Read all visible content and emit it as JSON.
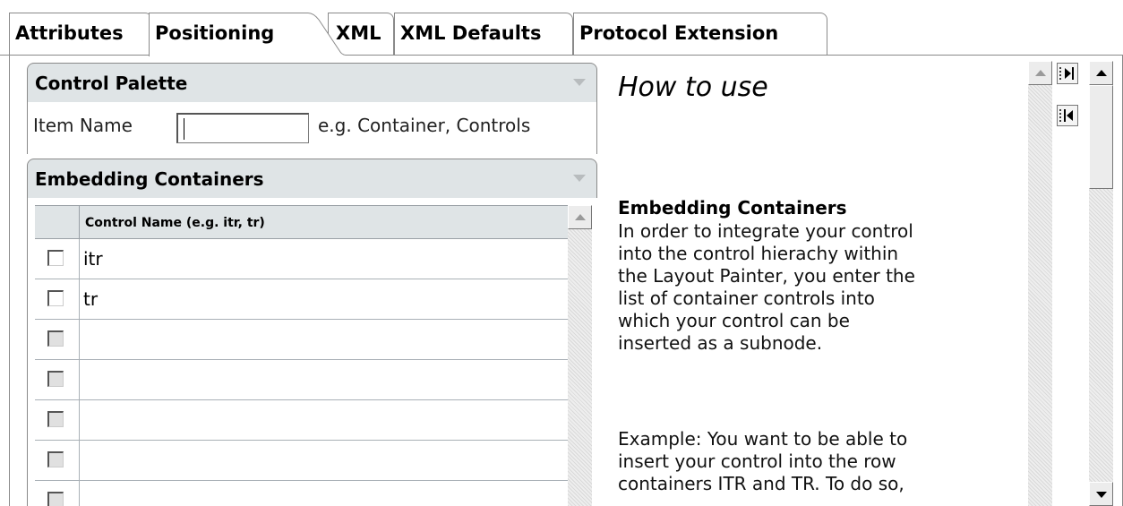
{
  "tabs": [
    {
      "label": "Attributes",
      "active": false
    },
    {
      "label": "Positioning",
      "active": true
    },
    {
      "label": "XML",
      "active": false
    },
    {
      "label": "XML Defaults",
      "active": false
    },
    {
      "label": "Protocol Extension",
      "active": false
    }
  ],
  "control_palette": {
    "title": "Control Palette",
    "item_name_label": "Item Name",
    "item_name_value": "",
    "hint": "e.g. Container, Controls"
  },
  "embedding_containers": {
    "title": "Embedding Containers",
    "column_header": "Control Name (e.g. itr, tr)",
    "rows": [
      {
        "checked": false,
        "name": "itr",
        "enabled": true
      },
      {
        "checked": false,
        "name": "tr",
        "enabled": true
      },
      {
        "checked": false,
        "name": "",
        "enabled": false
      },
      {
        "checked": false,
        "name": "",
        "enabled": false
      },
      {
        "checked": false,
        "name": "",
        "enabled": false
      },
      {
        "checked": false,
        "name": "",
        "enabled": false
      },
      {
        "checked": false,
        "name": "",
        "enabled": false
      }
    ]
  },
  "help": {
    "title": "How to use",
    "section_title": "Embedding Containers",
    "paragraph1": "In order to integrate your control\ninto the control hierachy within\nthe Layout Painter, you enter the\nlist of container controls into\nwhich your control can be\ninserted as a subnode.",
    "paragraph2": "Example: You want to be able to\ninsert your control into the row\ncontainers ITR and TR. To do so,"
  },
  "icons": {
    "tab_slope": "tab-curve",
    "panel_toggle": "collapse-triangle-icon",
    "scroll_up": "scroll-up-arrow-icon",
    "scroll_down": "scroll-down-arrow-icon",
    "help_expand": "expand-right-icon",
    "help_collapse": "collapse-left-icon"
  },
  "colors": {
    "panel_header_bg": "#dfe4e6",
    "border": "#8a8a8a",
    "scroll_track": "#eeeeee"
  }
}
